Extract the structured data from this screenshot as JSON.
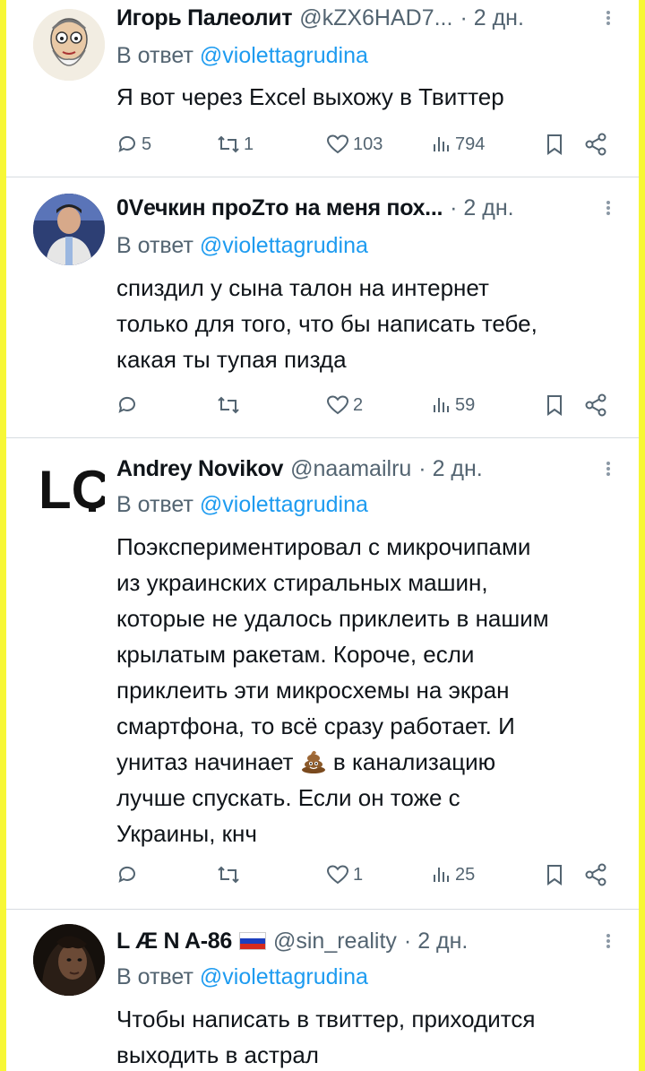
{
  "tweets": [
    {
      "name": "Игорь Палеолит",
      "handle": "@kZX6HAD7...",
      "time": "· 2 дн.",
      "reply_prefix": "В ответ",
      "reply_to": "@violettagrudina",
      "text": "Я вот через Excel выхожу в Твиттер",
      "replies": "5",
      "retweets": "1",
      "likes": "103",
      "views": "794",
      "avatar_icon": "cartoon-old-man-avatar"
    },
    {
      "name": "0Vечкин проZто на меня пох...",
      "handle": "",
      "time": "· 2 дн.",
      "reply_prefix": "В ответ",
      "reply_to": "@violettagrudina",
      "text_lines": [
        "спиздил у сына талон на интернет",
        "только для того, что бы написать тебе,",
        "какая ты тупая пизда"
      ],
      "replies": "",
      "retweets": "",
      "likes": "2",
      "views": "59",
      "avatar_icon": "person-photo-avatar"
    },
    {
      "name": "Andrey Novikov",
      "handle": "@naamailru",
      "time": "· 2 дн.",
      "reply_prefix": "В ответ",
      "reply_to": "@violettagrudina",
      "text_lines": [
        "Поэкспериментировал с микрочипами",
        "из украинских стиральных машин,",
        "которые не удалось приклеить в нашим",
        "крылатым ракетам. Короче, если",
        "приклеить эти микросхемы на экран",
        "смартфона, то всё сразу работает. И",
        "унитаз начинает",
        "в канализацию",
        "лучше спускать. Если он тоже с",
        "Украины, кнч"
      ],
      "emoji": "pile-of-poo-emoji",
      "replies": "",
      "retweets": "",
      "likes": "1",
      "views": "25",
      "avatar_icon": "lc-logo-avatar",
      "avatar_text": "LC"
    },
    {
      "name": "L Æ N A-86",
      "handle": "@sin_reality",
      "time": "· 2 дн.",
      "reply_prefix": "В ответ",
      "reply_to": "@violettagrudina",
      "text_lines": [
        "Чтобы написать в твиттер, приходится",
        "выходить в астрал"
      ],
      "flag": "russia-flag-icon",
      "avatar_icon": "dark-portrait-avatar"
    }
  ],
  "colors": {
    "border_yellow": "#f7f735",
    "text": "#0f1419",
    "secondary": "#536471",
    "link": "#1d9bf0"
  }
}
